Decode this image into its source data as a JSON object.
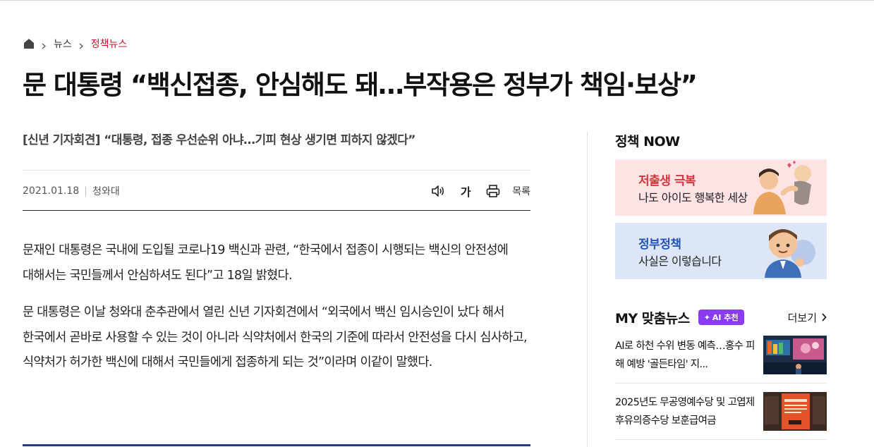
{
  "breadcrumb": {
    "items": [
      "뉴스",
      "정책뉴스"
    ]
  },
  "article": {
    "headline": "문 대통령 “백신접종, 안심해도 돼…부작용은 정부가 책임·보상”",
    "subtitle": "[신년 기자회견] “대통령, 접종 우선순위 아냐…기피 현상 생기면 피하지 않겠다”",
    "date": "2021.01.18",
    "source": "청와대",
    "font_size_label": "가",
    "list_label": "목록",
    "paragraphs": [
      "문재인 대통령은 국내에 도입될 코로나19 백신과 관련, “한국에서 접종이 시행되는 백신의 안전성에 대해서는 국민들께서 안심하셔도 된다”고 18일 밝혔다.",
      "문 대통령은 이날 청와대 춘추관에서 열린 신년 기자회견에서 “외국에서 백신 임시승인이 났다 해서 한국에서 곧바로 사용할 수 있는 것이 아니라 식약처에서 한국의 기준에 따라서 안전성을 다시 심사하고, 식약처가 허가한 백신에 대해서 국민들에게 접종하게 되는 것”이라며 이같이 말했다."
    ]
  },
  "sidebar": {
    "policy_now_title": "정책 NOW",
    "banners": [
      {
        "line1": "저출생 극복",
        "line2": "나도 아이도 행복한 세상"
      },
      {
        "line1": "정부정책",
        "line2": "사실은 이렇습니다"
      }
    ],
    "my_news": {
      "title": "MY 맞춤뉴스",
      "badge": "AI 추천",
      "more": "더보기",
      "items": [
        {
          "text": "AI로 하천 수위 변동 예측…홍수 피해 예방 '골든타임' 지..."
        },
        {
          "text": "2025년도 무공영예수당 및 고엽제후유의증수당 보훈급여금"
        }
      ]
    }
  },
  "colors": {
    "accent_red": "#c8102e",
    "ai_badge": "#8b3cf2",
    "bottom_bar": "#1f3f7f"
  }
}
